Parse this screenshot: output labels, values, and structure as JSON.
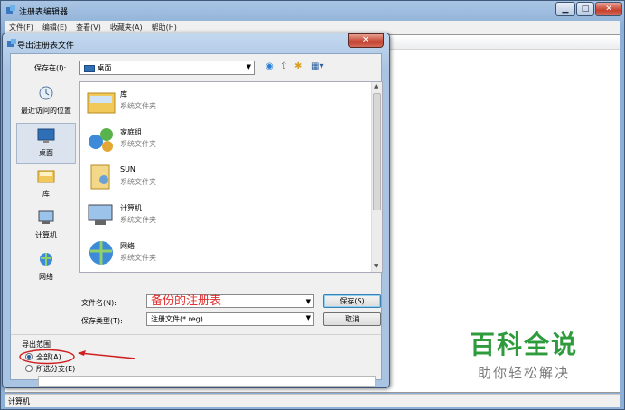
{
  "main_window": {
    "title": "注册表编辑器",
    "menu": [
      "文件(F)",
      "编辑(E)",
      "查看(V)",
      "收藏夹(A)",
      "帮助(H)"
    ],
    "status": "计算机"
  },
  "dialog": {
    "title": "导出注册表文件",
    "save_in_label": "保存在(I):",
    "save_in_value": "桌面",
    "places": [
      {
        "label": "最近访问的位置",
        "icon": "recent-places-icon"
      },
      {
        "label": "桌面",
        "icon": "desktop-icon",
        "selected": true
      },
      {
        "label": "库",
        "icon": "libraries-icon"
      },
      {
        "label": "计算机",
        "icon": "computer-icon"
      },
      {
        "label": "网络",
        "icon": "network-icon"
      }
    ],
    "files": [
      {
        "name": "库",
        "desc": "系统文件夹",
        "icon": "libraries-folder-icon"
      },
      {
        "name": "家庭组",
        "desc": "系统文件夹",
        "icon": "homegroup-icon"
      },
      {
        "name": "SUN",
        "desc": "系统文件夹",
        "icon": "user-folder-icon"
      },
      {
        "name": "计算机",
        "desc": "系统文件夹",
        "icon": "computer-icon"
      },
      {
        "name": "网络",
        "desc": "系统文件夹",
        "icon": "network-icon"
      }
    ],
    "filename_label": "文件名(N):",
    "filename_value": "备份的注册表",
    "filetype_label": "保存类型(T):",
    "filetype_value": "注册文件(*.reg)",
    "save_button": "保存(S)",
    "cancel_button": "取消",
    "export_range_label": "导出范围",
    "range_all": "全部(A)",
    "range_branch": "所选分支(E)"
  },
  "watermark": {
    "line1": "百科全说",
    "line2": "助你轻松解决"
  },
  "colors": {
    "filename_text": "#e03030",
    "watermark_green": "#2e9b3c",
    "annotation_red": "#d02020"
  }
}
